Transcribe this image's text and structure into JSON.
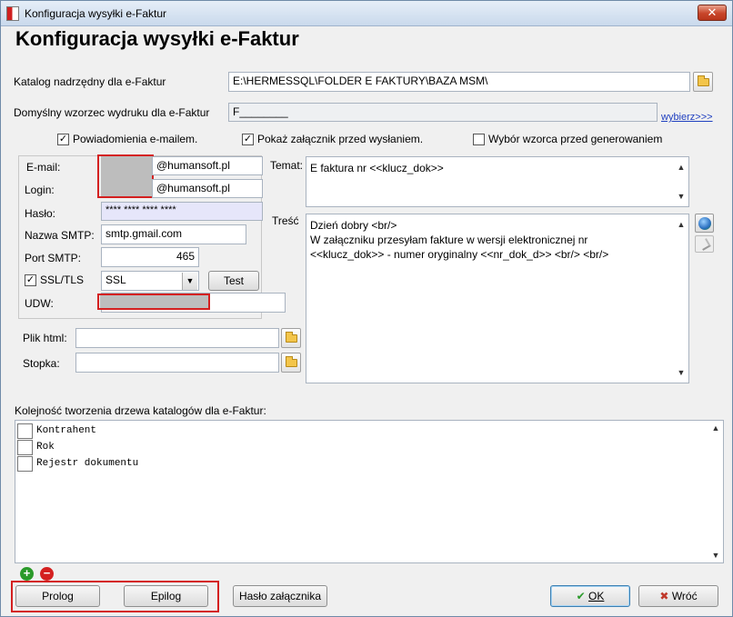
{
  "window": {
    "title": "Konfiguracja wysyłki e-Faktur",
    "close_glyph": "✕"
  },
  "header": {
    "title": "Konfiguracja wysyłki e-Faktur"
  },
  "catalog": {
    "label": "Katalog nadrzędny dla e-Faktur",
    "value": "E:\\HERMESSQL\\FOLDER E FAKTURY\\BAZA MSM\\"
  },
  "template": {
    "label": "Domyślny wzorzec wydruku dla e-Faktur",
    "value": "F________",
    "choose_link": "wybierz>>>"
  },
  "options": {
    "email_notify": {
      "label": "Powiadomienia e-mailem.",
      "checked": true
    },
    "show_attachment": {
      "label": "Pokaż załącznik przed wysłaniem.",
      "checked": true
    },
    "choose_template": {
      "label": "Wybór wzorca przed generowaniem",
      "checked": false
    }
  },
  "smtp": {
    "email_label": "E-mail:",
    "email_domain": "@humansoft.pl",
    "login_label": "Login:",
    "login_domain": "@humansoft.pl",
    "password_label": "Hasło:",
    "password_value": "**** **** **** ****",
    "smtp_label": "Nazwa SMTP:",
    "smtp_value": "smtp.gmail.com",
    "port_label": "Port SMTP:",
    "port_value": "465",
    "ssl_label": "SSL/TLS",
    "ssl_checked": true,
    "ssl_option": "SSL",
    "test_button": "Test",
    "udw_label": "UDW:"
  },
  "files": {
    "html_label": "Plik html:",
    "footer_label": "Stopka:"
  },
  "message": {
    "subject_label": "Temat:",
    "subject_value": "E faktura  nr <<klucz_dok>>",
    "body_label": "Treść",
    "body_line1": "Dzień dobry <br/>",
    "body_line2": "W załączniku przesyłam fakture w wersji elektronicznej nr",
    "body_line3": "<<klucz_dok>> - numer oryginalny <<nr_dok_d>> <br/> <br/>"
  },
  "tree": {
    "label": "Kolejność tworzenia drzewa katalogów dla e-Faktur:",
    "items": [
      "Kontrahent",
      "Rok",
      "Rejestr dokumentu"
    ]
  },
  "footer": {
    "add_glyph": "+",
    "remove_glyph": "−",
    "prolog": "Prolog",
    "epilog": "Epilog",
    "attachment_password": "Hasło załącznika",
    "ok": "OK",
    "back": "Wróć",
    "ok_glyph": "✔",
    "back_glyph": "✖"
  },
  "colors": {
    "highlight_red": "#d42020",
    "password_bg": "#e6e6fa"
  }
}
